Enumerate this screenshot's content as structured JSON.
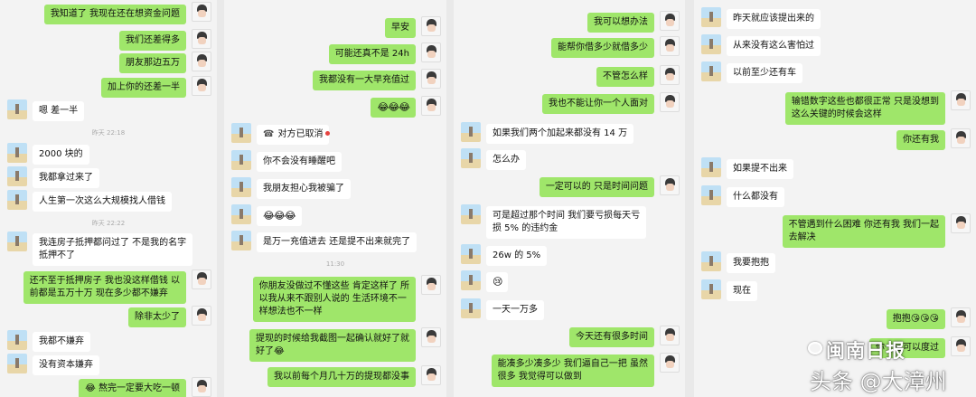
{
  "panels": [
    {
      "messages": [
        {
          "side": "out",
          "text": "我知道了 我现在还在想资金问题"
        },
        {
          "side": "out",
          "text": "我们还差得多"
        },
        {
          "side": "out",
          "text": "朋友那边五万"
        },
        {
          "side": "out",
          "text": "加上你的还差一半"
        },
        {
          "side": "in",
          "text": "嗯 差一半"
        },
        {
          "type": "time",
          "text": "昨天 22:18"
        },
        {
          "side": "in",
          "text": "2000 块的"
        },
        {
          "side": "in",
          "text": "我都拿过来了"
        },
        {
          "side": "in",
          "text": "人生第一次这么大规模找人借钱"
        },
        {
          "type": "time",
          "text": "昨天 22:22"
        },
        {
          "side": "in",
          "text": "我连房子抵押都问过了 不是我的名字\n抵押不了"
        },
        {
          "side": "out",
          "text": "还不至于抵押房子 我也没这样借钱 以\n前都是五万十万 现在多少都不嫌弃"
        },
        {
          "side": "out",
          "text": "除非太少了"
        },
        {
          "side": "in",
          "text": "我都不嫌弃"
        },
        {
          "side": "in",
          "text": "没有资本嫌弃"
        },
        {
          "side": "out",
          "text": "😂 熬完一定要大吃一顿"
        }
      ]
    },
    {
      "messages": [
        {
          "side": "out",
          "text": "早安"
        },
        {
          "side": "out",
          "text": "可能还真不是 24h"
        },
        {
          "side": "out",
          "text": "我都没有一大早充值过"
        },
        {
          "side": "out",
          "text": "😂😂😂",
          "emoji": true
        },
        {
          "side": "in",
          "text": "对方已取消",
          "retract": true
        },
        {
          "side": "in",
          "text": "你不会没有睡醒吧"
        },
        {
          "side": "in",
          "text": "我朋友担心我被骗了"
        },
        {
          "side": "in",
          "text": "😂😂😂",
          "emoji": true
        },
        {
          "side": "in",
          "text": "是万一充值进去 还是提不出来就完了"
        },
        {
          "type": "time",
          "text": "11:30"
        },
        {
          "side": "out",
          "text": "你朋友没做过不懂这些 肯定这样了 所\n以我从来不跟别人说的 生活环境不一\n样想法也不一样"
        },
        {
          "side": "out",
          "text": "提现的时候给我截图一起确认就好了就\n好了😂"
        },
        {
          "side": "out",
          "text": "我以前每个月几十万的提现都没事"
        }
      ]
    },
    {
      "messages": [
        {
          "side": "out",
          "text": "我可以想办法"
        },
        {
          "side": "out",
          "text": "能帮你借多少就借多少"
        },
        {
          "side": "out",
          "text": "不管怎么样"
        },
        {
          "side": "out",
          "text": "我也不能让你一个人面对"
        },
        {
          "side": "in",
          "text": "如果我们两个加起来都没有 14 万"
        },
        {
          "side": "in",
          "text": "怎么办"
        },
        {
          "side": "out",
          "text": "一定可以的 只是时间问题"
        },
        {
          "side": "in",
          "text": "可是超过那个时间 我们要亏损每天亏\n损 5% 的违约金"
        },
        {
          "side": "in",
          "text": "26w 的 5%"
        },
        {
          "side": "in",
          "text": "😢",
          "emoji": true
        },
        {
          "side": "in",
          "text": "一天一万多"
        },
        {
          "side": "out",
          "text": "今天还有很多时间"
        },
        {
          "side": "out",
          "text": "能凑多少凑多少 我们逼自己一把 虽然\n很多 我觉得可以做到"
        }
      ]
    },
    {
      "messages": [
        {
          "side": "in",
          "text": "昨天就应该提出来的"
        },
        {
          "side": "in",
          "text": "从来没有这么害怕过"
        },
        {
          "side": "in",
          "text": "以前至少还有车"
        },
        {
          "side": "out",
          "text": "输错数字这些也都很正常 只是没想到\n这么关键的时候会这样"
        },
        {
          "side": "out",
          "text": "你还有我"
        },
        {
          "side": "in",
          "text": "如果提不出来"
        },
        {
          "side": "in",
          "text": "什么都没有"
        },
        {
          "side": "out",
          "text": "不管遇到什么困难 你还有我 我们一起\n去解决"
        },
        {
          "side": "in",
          "text": "我要抱抱"
        },
        {
          "side": "in",
          "text": "现在"
        },
        {
          "side": "out",
          "text": "抱抱😘😘😘"
        },
        {
          "side": "out",
          "text": "你一定可以度过"
        }
      ]
    }
  ],
  "watermark": {
    "source": "闽南日报",
    "line": "头条 @大漳州"
  }
}
